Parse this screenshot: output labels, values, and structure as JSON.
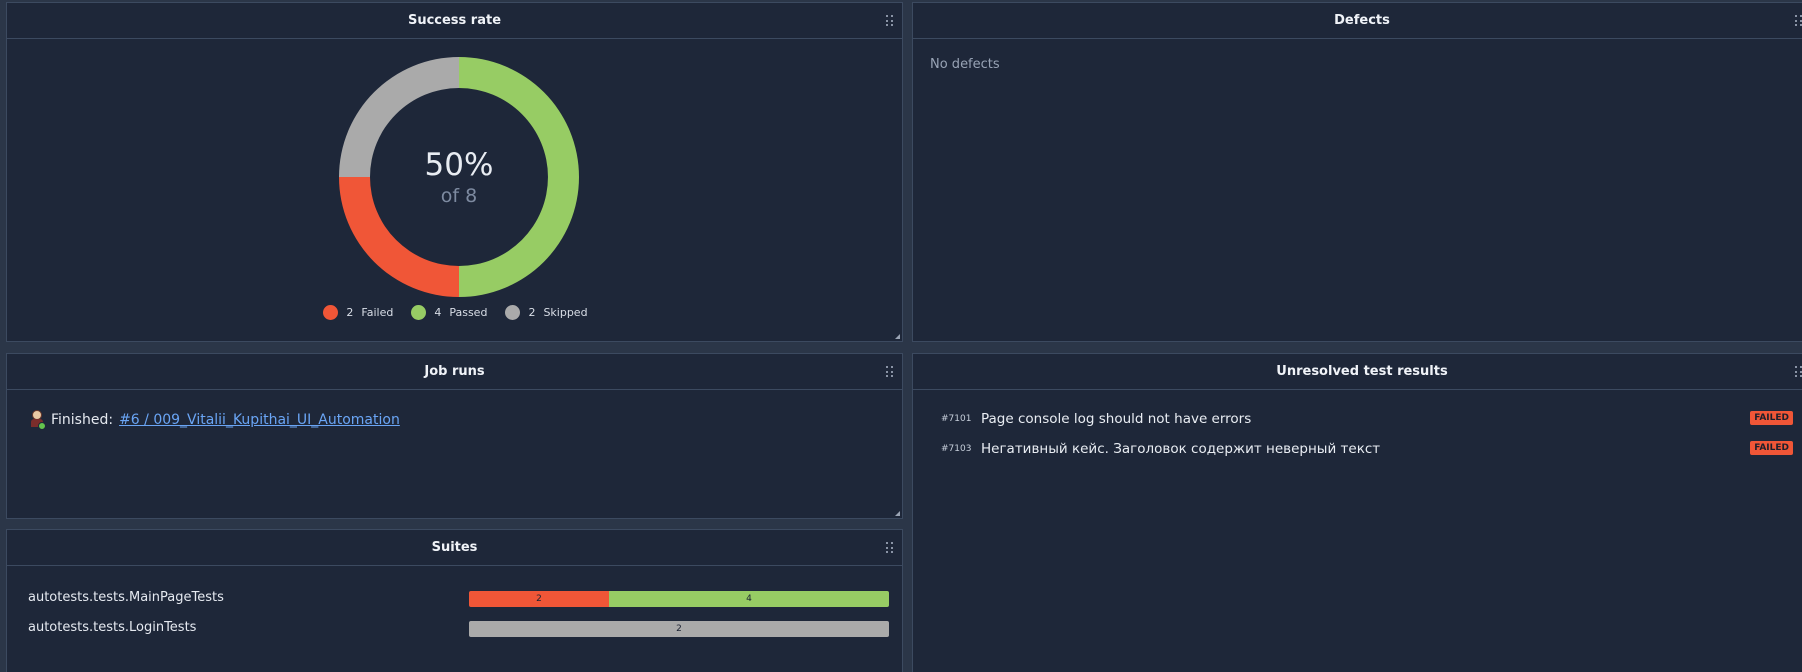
{
  "success_rate": {
    "title": "Success rate",
    "percent_label": "50%",
    "of_label": "of 8",
    "legend": [
      {
        "count": "2",
        "label": "Failed",
        "color": "#f05637"
      },
      {
        "count": "4",
        "label": "Passed",
        "color": "#97cc64"
      },
      {
        "count": "2",
        "label": "Skipped",
        "color": "#aaaaaa"
      }
    ],
    "chart_data": {
      "type": "pie",
      "categories": [
        "Failed",
        "Passed",
        "Skipped"
      ],
      "values": [
        2,
        4,
        2
      ],
      "colors": [
        "#f05637",
        "#97cc64",
        "#aaaaaa"
      ]
    }
  },
  "defects": {
    "title": "Defects",
    "empty_text": "No defects"
  },
  "job_runs": {
    "title": "Job runs",
    "status_prefix": "Finished:",
    "job_link": "#6 / 009_Vitalii_Kupithai_UI_Automation"
  },
  "suites": {
    "title": "Suites",
    "rows": [
      {
        "name": "autotests.tests.MainPageTests",
        "segments": [
          {
            "value": "2",
            "color": "#f05637",
            "share": 2
          },
          {
            "value": "4",
            "color": "#97cc64",
            "share": 4
          }
        ]
      },
      {
        "name": "autotests.tests.LoginTests",
        "segments": [
          {
            "value": "2",
            "color": "#aaaaaa",
            "share": 2
          }
        ]
      }
    ]
  },
  "unresolved": {
    "title": "Unresolved test results",
    "rows": [
      {
        "id": "#7101",
        "name": "Page console log should not have errors",
        "status": "FAILED"
      },
      {
        "id": "#7103",
        "name": "Негативный кейс. Заголовок содержит неверный текст",
        "status": "FAILED"
      }
    ]
  }
}
